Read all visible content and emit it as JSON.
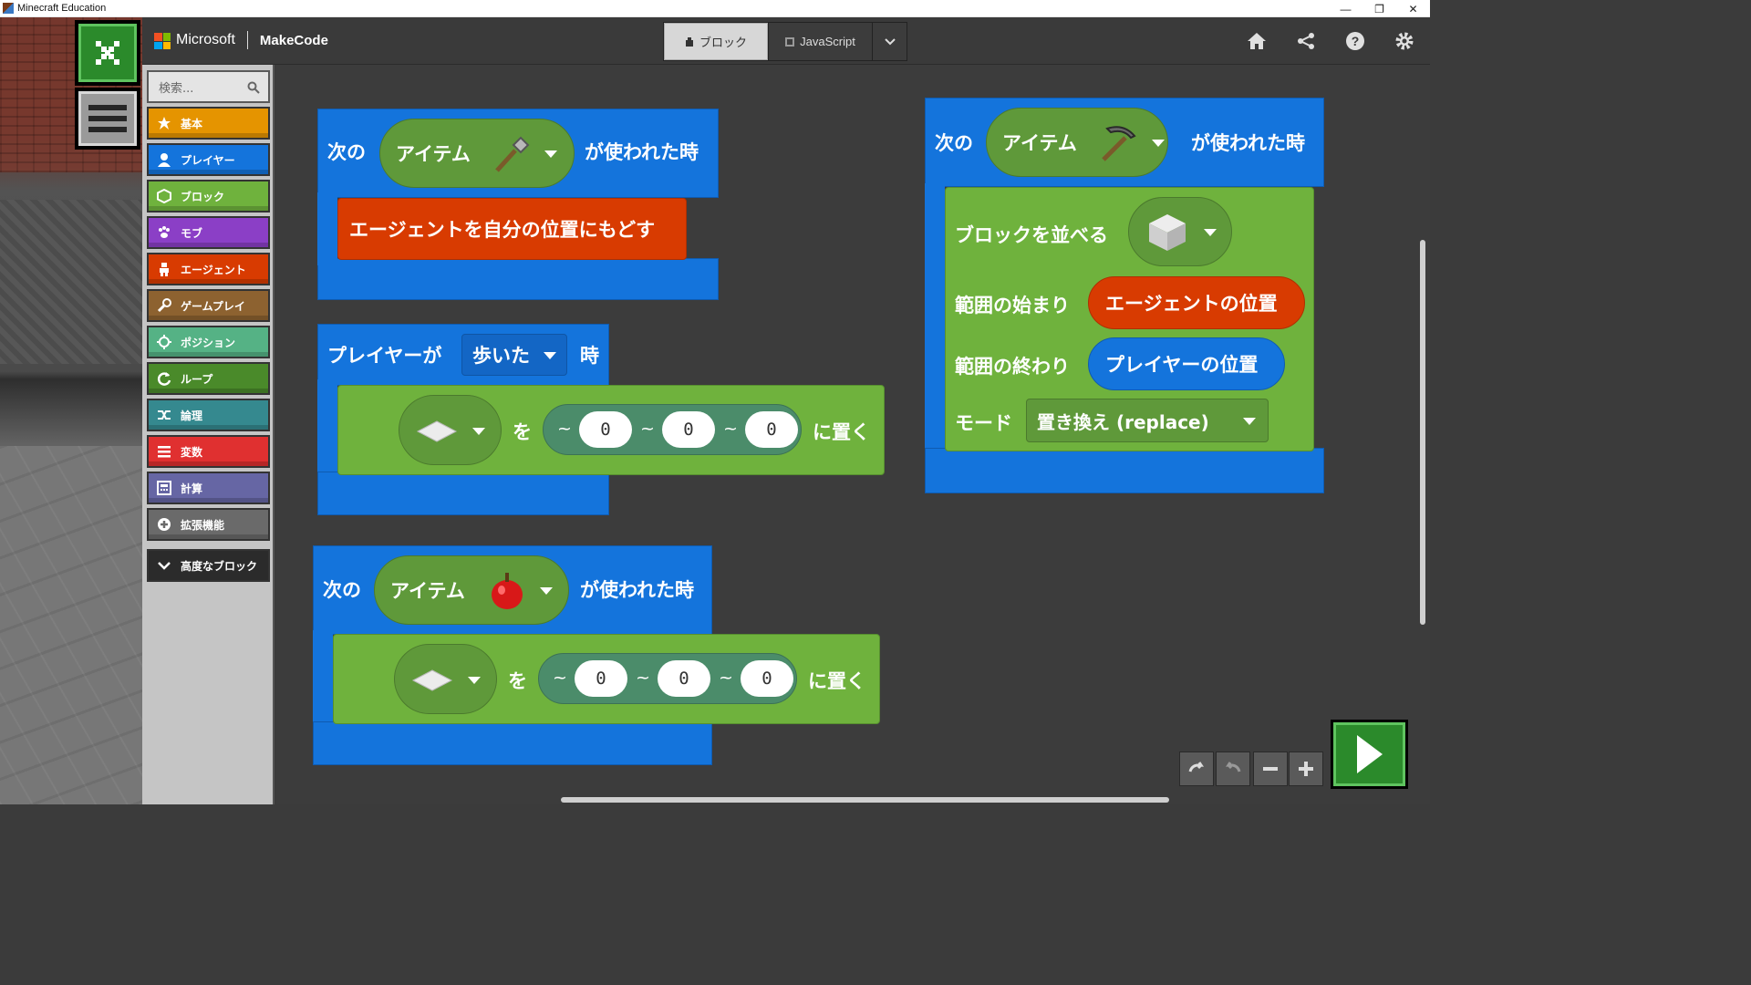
{
  "window": {
    "title": "Minecraft Education",
    "minimize": "—",
    "restore": "❐",
    "close": "✕"
  },
  "header": {
    "brand": "Microsoft",
    "product": "MakeCode",
    "tabs": [
      {
        "label": "ブロック"
      },
      {
        "label": "JavaScript"
      }
    ]
  },
  "toolbox": {
    "search_placeholder": "検索...",
    "categories": [
      {
        "label": "基本",
        "color": "#e59400"
      },
      {
        "label": "プレイヤー",
        "color": "#1474dc"
      },
      {
        "label": "ブロック",
        "color": "#6fb23d"
      },
      {
        "label": "モブ",
        "color": "#8b3fc6"
      },
      {
        "label": "エージェント",
        "color": "#d83b01"
      },
      {
        "label": "ゲームプレイ",
        "color": "#8d6230"
      },
      {
        "label": "ポジション",
        "color": "#55b285"
      },
      {
        "label": "ループ",
        "color": "#4a8a2a"
      },
      {
        "label": "論理",
        "color": "#35898f"
      },
      {
        "label": "変数",
        "color": "#e03030"
      },
      {
        "label": "計算",
        "color": "#6666a4"
      },
      {
        "label": "拡張機能",
        "color": "#6a6a6a"
      },
      {
        "label": "高度なブロック",
        "color": "#2b2b2b"
      }
    ]
  },
  "blocks": {
    "b1": {
      "pre": "次の",
      "item": "アイテム",
      "post": "が使われた時",
      "action": "エージェントを自分の位置にもどす"
    },
    "b2": {
      "pre": "プレイヤーが",
      "dropdown": "歩いた",
      "post": "時",
      "wo": "を",
      "place": "に置く",
      "x": "0",
      "y": "0",
      "z": "0",
      "tilde": "~"
    },
    "b3": {
      "pre": "次の",
      "item": "アイテム",
      "post": "が使われた時",
      "wo": "を",
      "place": "に置く",
      "x": "0",
      "y": "0",
      "z": "0",
      "tilde": "~"
    },
    "b4": {
      "pre": "次の",
      "item": "アイテム",
      "post": "が使われた時",
      "fill": "ブロックを並べる",
      "from": "範囲の始まり",
      "from_val": "エージェントの位置",
      "to": "範囲の終わり",
      "to_val": "プレイヤーの位置",
      "mode": "モード",
      "mode_val": "置き換え (replace)"
    }
  }
}
